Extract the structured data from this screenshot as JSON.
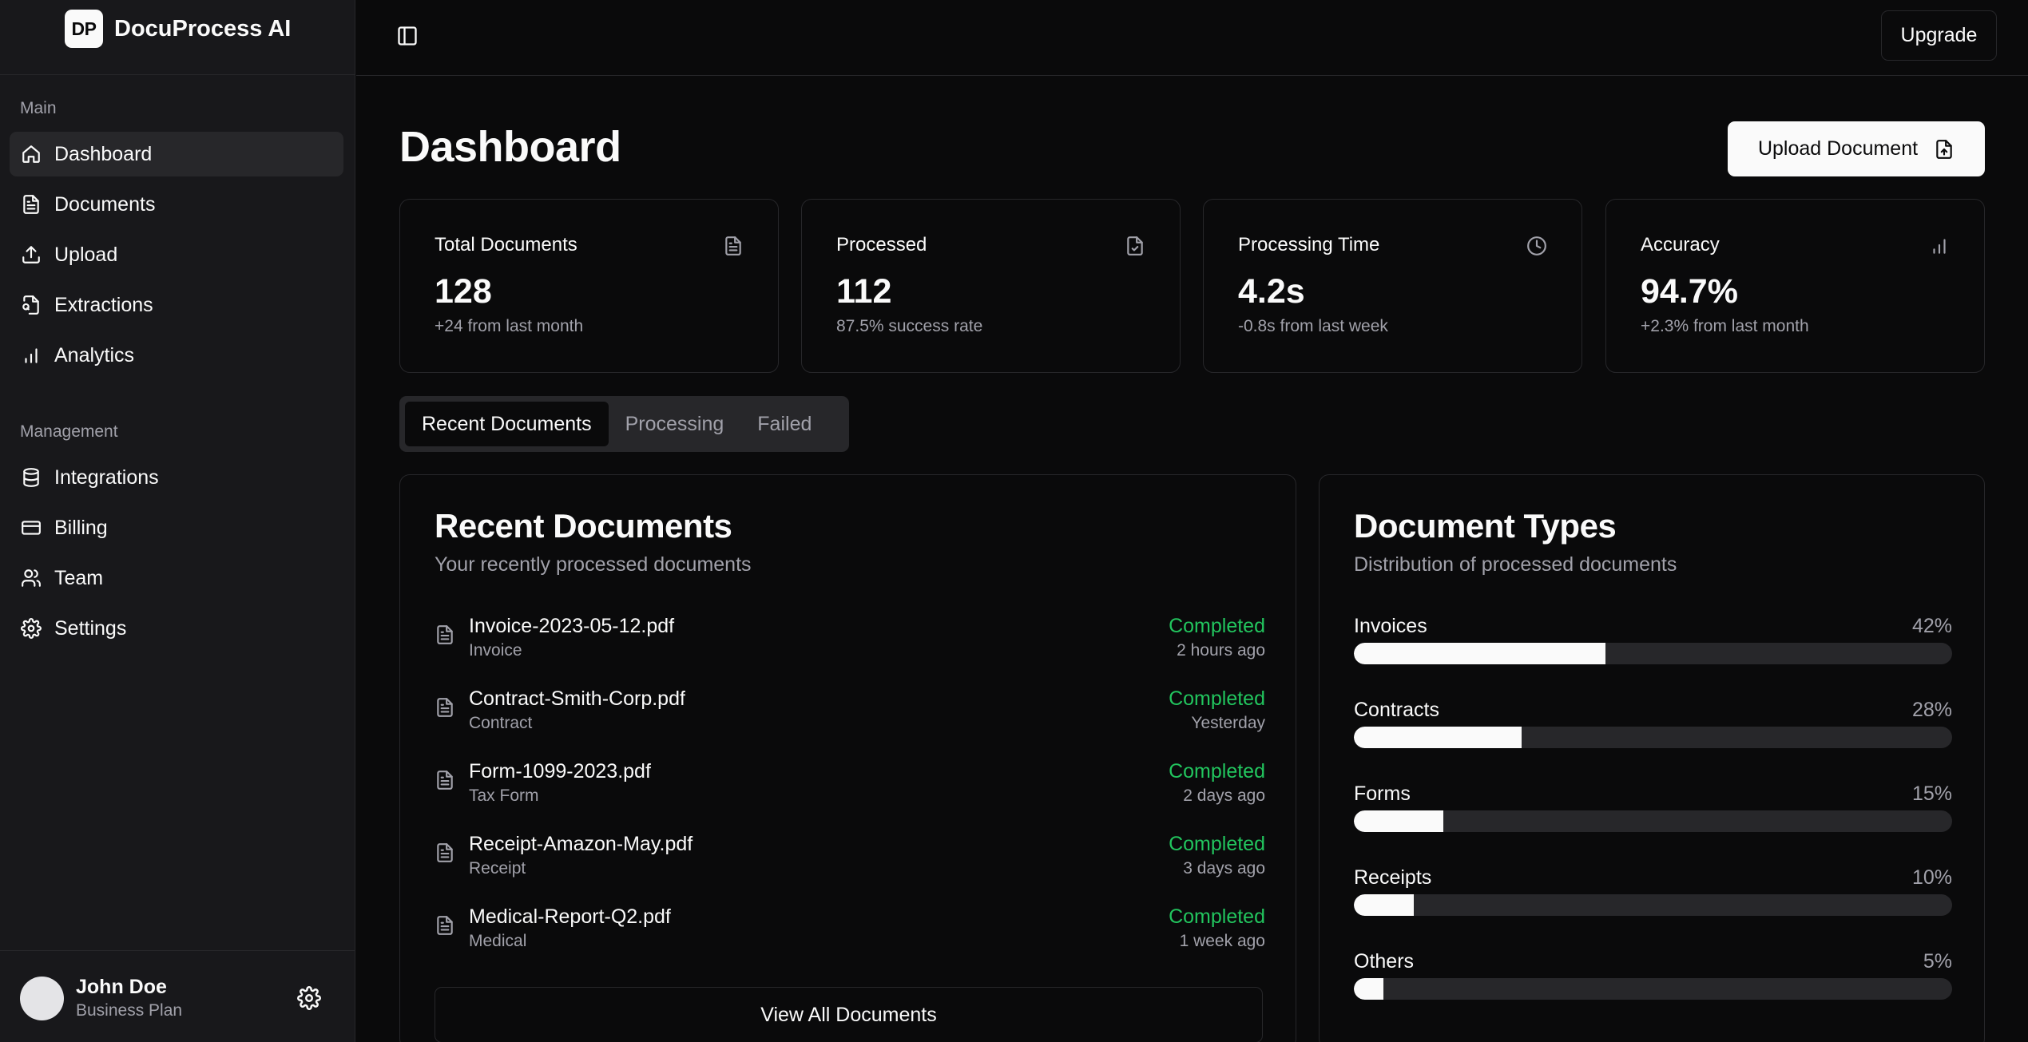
{
  "brand": {
    "logo_text": "DP",
    "name": "DocuProcess AI"
  },
  "sidebar": {
    "main_label": "Main",
    "main_items": [
      {
        "label": "Dashboard",
        "icon": "home-icon",
        "active": true
      },
      {
        "label": "Documents",
        "icon": "file-text-icon"
      },
      {
        "label": "Upload",
        "icon": "upload-icon"
      },
      {
        "label": "Extractions",
        "icon": "file-search-icon"
      },
      {
        "label": "Analytics",
        "icon": "bar-chart-icon"
      }
    ],
    "management_label": "Management",
    "management_items": [
      {
        "label": "Integrations",
        "icon": "database-icon"
      },
      {
        "label": "Billing",
        "icon": "credit-card-icon"
      },
      {
        "label": "Team",
        "icon": "users-icon"
      },
      {
        "label": "Settings",
        "icon": "gear-icon"
      }
    ]
  },
  "user": {
    "name": "John Doe",
    "plan": "Business Plan"
  },
  "topbar": {
    "upgrade_label": "Upgrade"
  },
  "page": {
    "title": "Dashboard",
    "upload_label": "Upload Document"
  },
  "stats": [
    {
      "title": "Total Documents",
      "value": "128",
      "sub": "+24 from last month",
      "icon": "file-text-icon"
    },
    {
      "title": "Processed",
      "value": "112",
      "sub": "87.5% success rate",
      "icon": "file-check-icon"
    },
    {
      "title": "Processing Time",
      "value": "4.2s",
      "sub": "-0.8s from last week",
      "icon": "clock-icon"
    },
    {
      "title": "Accuracy",
      "value": "94.7%",
      "sub": "+2.3% from last month",
      "icon": "bar-chart-icon"
    }
  ],
  "tabs": [
    "Recent Documents",
    "Processing",
    "Failed"
  ],
  "recent": {
    "title": "Recent Documents",
    "description": "Your recently processed documents",
    "documents": [
      {
        "name": "Invoice-2023-05-12.pdf",
        "type": "Invoice",
        "status": "Completed",
        "time": "2 hours ago"
      },
      {
        "name": "Contract-Smith-Corp.pdf",
        "type": "Contract",
        "status": "Completed",
        "time": "Yesterday"
      },
      {
        "name": "Form-1099-2023.pdf",
        "type": "Tax Form",
        "status": "Completed",
        "time": "2 days ago"
      },
      {
        "name": "Receipt-Amazon-May.pdf",
        "type": "Receipt",
        "status": "Completed",
        "time": "3 days ago"
      },
      {
        "name": "Medical-Report-Q2.pdf",
        "type": "Medical",
        "status": "Completed",
        "time": "1 week ago"
      }
    ],
    "view_all_label": "View All Documents"
  },
  "types": {
    "title": "Document Types",
    "description": "Distribution of processed documents",
    "items": [
      {
        "label": "Invoices",
        "pct_label": "42%",
        "value": 42
      },
      {
        "label": "Contracts",
        "pct_label": "28%",
        "value": 28
      },
      {
        "label": "Forms",
        "pct_label": "15%",
        "value": 15
      },
      {
        "label": "Receipts",
        "pct_label": "10%",
        "value": 10
      },
      {
        "label": "Others",
        "pct_label": "5%",
        "value": 5
      }
    ]
  },
  "colors": {
    "background": "#0a0a0b",
    "sidebar": "#18181b",
    "border": "#27272a",
    "success": "#22c55e",
    "muted": "#a1a1aa"
  }
}
